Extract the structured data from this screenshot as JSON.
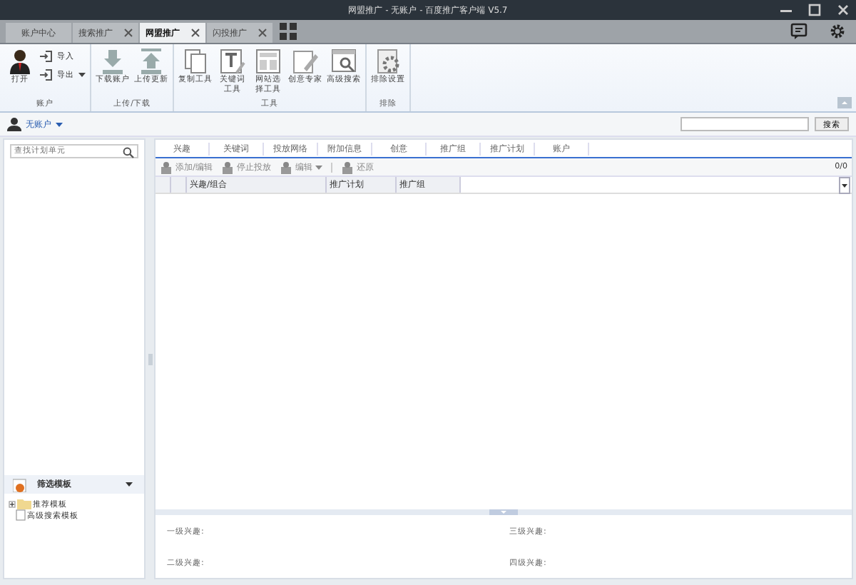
{
  "window": {
    "title": "网盟推广 - 无账户 - 百度推广客户端 V5.7"
  },
  "tabs": [
    {
      "label": "账户中心",
      "selected": false,
      "closable": false
    },
    {
      "label": "搜索推广",
      "selected": false,
      "closable": true
    },
    {
      "label": "网盟推广",
      "selected": true,
      "closable": true
    },
    {
      "label": "闪投推广",
      "selected": false,
      "closable": true
    }
  ],
  "ribbon": [
    {
      "label": "账户",
      "items": [
        {
          "kind": "big",
          "label": "打开"
        },
        {
          "kind": "small",
          "label": "导入",
          "dropdown": false
        },
        {
          "kind": "small",
          "label": "导出",
          "dropdown": true
        }
      ]
    },
    {
      "label": "上传/下载",
      "items": [
        {
          "kind": "big",
          "label": "下载账户"
        },
        {
          "kind": "big",
          "label": "上传更新"
        }
      ]
    },
    {
      "label": "工具",
      "items": [
        {
          "kind": "big",
          "label": "复制工具"
        },
        {
          "kind": "big",
          "label": "关键词工具"
        },
        {
          "kind": "big",
          "label": "网站选择工具"
        },
        {
          "kind": "big",
          "label": "创意专家"
        },
        {
          "kind": "big",
          "label": "高级搜索"
        }
      ]
    },
    {
      "label": "排除",
      "items": [
        {
          "kind": "big",
          "label": "排除设置"
        }
      ]
    }
  ],
  "account": {
    "label": "无账户"
  },
  "search_button": "搜索",
  "sidebar": {
    "search": {
      "placeholder": "查找计划单元"
    },
    "filter": {
      "title": "筛选模板"
    },
    "tree": [
      {
        "label": "推荐模板",
        "expanded": false
      },
      {
        "label": "高级搜索模板"
      }
    ]
  },
  "content_tabs": [
    "兴趣",
    "关键词",
    "投放网络",
    "附加信息",
    "创意",
    "推广组",
    "推广计划",
    "账户"
  ],
  "toolbar": [
    {
      "kind": "button",
      "label": "添加/编辑",
      "disabled": true
    },
    {
      "kind": "button",
      "label": "停止投放",
      "disabled": true
    },
    {
      "kind": "menu",
      "label": "编辑",
      "disabled": true
    },
    {
      "kind": "button",
      "label": "还原",
      "disabled": true
    }
  ],
  "count": "0/0",
  "table": {
    "columns": [
      "兴趣/组合",
      "推广计划",
      "推广组"
    ]
  },
  "details": [
    {
      "label": "一级兴趣:"
    },
    {
      "label": "三级兴趣:"
    },
    {
      "label": "二级兴趣:"
    },
    {
      "label": "四级兴趣:"
    }
  ]
}
